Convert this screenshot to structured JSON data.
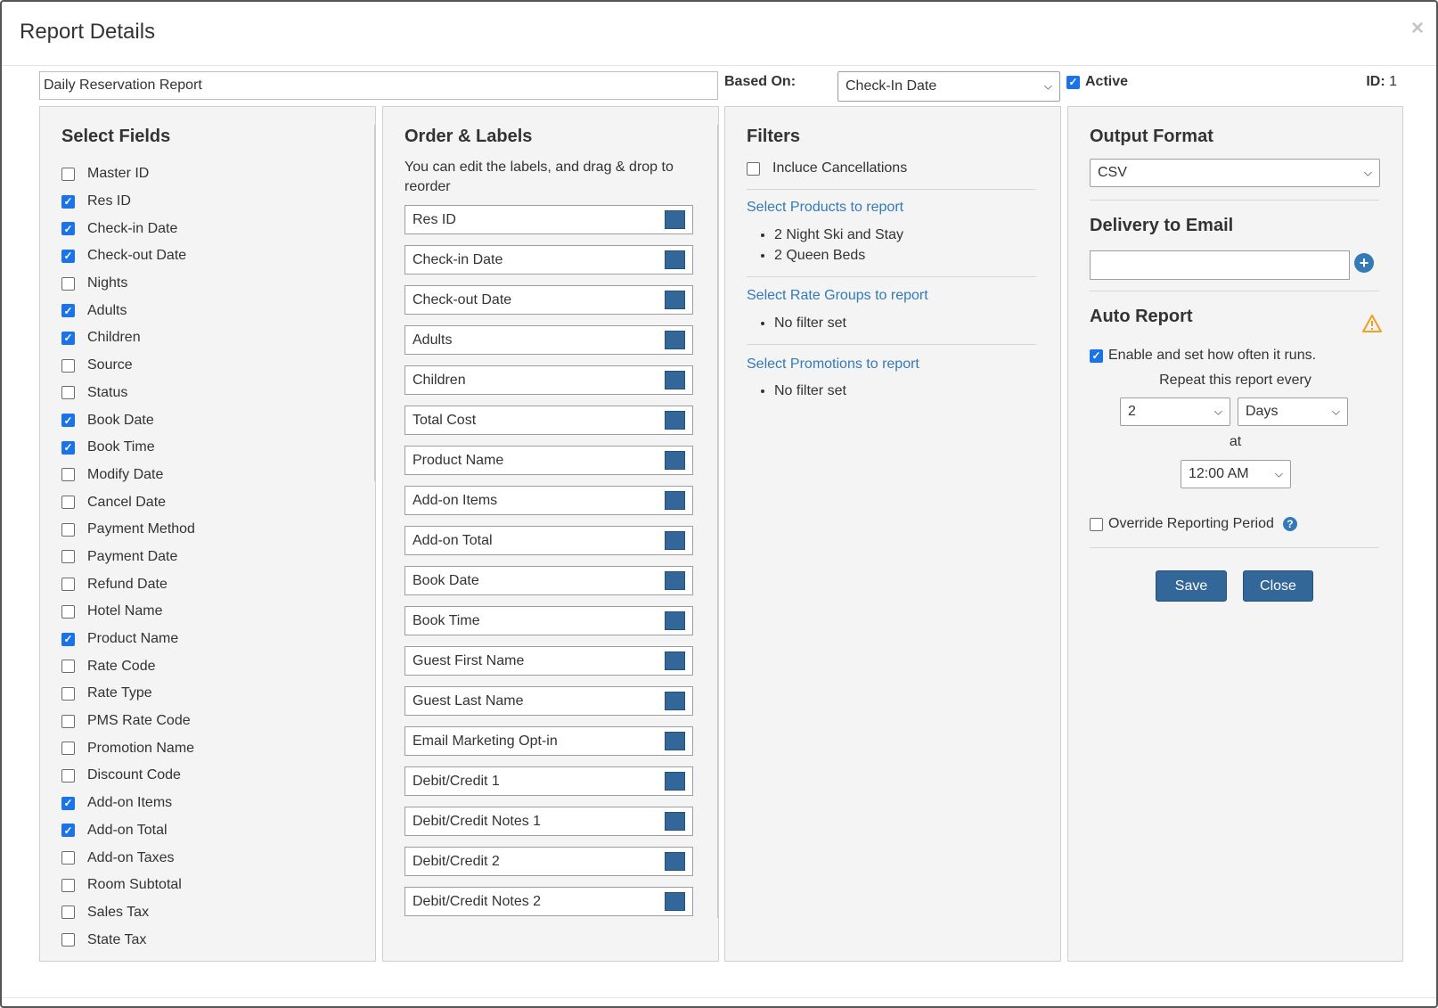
{
  "header": {
    "title": "Report Details",
    "close_symbol": "×"
  },
  "top": {
    "report_name": "Daily Reservation Report",
    "based_on_label": "Based On:",
    "based_on_value": "Check-In Date",
    "active_label": "Active",
    "active_checked": true,
    "id_label": "ID:",
    "id_value": "1"
  },
  "select_fields": {
    "title": "Select Fields",
    "items": [
      {
        "label": "Master ID",
        "checked": false
      },
      {
        "label": "Res ID",
        "checked": true
      },
      {
        "label": "Check-in Date",
        "checked": true
      },
      {
        "label": "Check-out Date",
        "checked": true
      },
      {
        "label": "Nights",
        "checked": false
      },
      {
        "label": "Adults",
        "checked": true
      },
      {
        "label": "Children",
        "checked": true
      },
      {
        "label": "Source",
        "checked": false
      },
      {
        "label": "Status",
        "checked": false
      },
      {
        "label": "Book Date",
        "checked": true
      },
      {
        "label": "Book Time",
        "checked": true
      },
      {
        "label": "Modify Date",
        "checked": false
      },
      {
        "label": "Cancel Date",
        "checked": false
      },
      {
        "label": "Payment Method",
        "checked": false
      },
      {
        "label": "Payment Date",
        "checked": false
      },
      {
        "label": "Refund Date",
        "checked": false
      },
      {
        "label": "Hotel Name",
        "checked": false
      },
      {
        "label": "Product Name",
        "checked": true
      },
      {
        "label": "Rate Code",
        "checked": false
      },
      {
        "label": "Rate Type",
        "checked": false
      },
      {
        "label": "PMS Rate Code",
        "checked": false
      },
      {
        "label": "Promotion Name",
        "checked": false
      },
      {
        "label": "Discount Code",
        "checked": false
      },
      {
        "label": "Add-on Items",
        "checked": true
      },
      {
        "label": "Add-on Total",
        "checked": true
      },
      {
        "label": "Add-on Taxes",
        "checked": false
      },
      {
        "label": "Room Subtotal",
        "checked": false
      },
      {
        "label": "Sales Tax",
        "checked": false
      },
      {
        "label": "State Tax",
        "checked": false
      }
    ]
  },
  "order_labels": {
    "title": "Order & Labels",
    "hint": "You can edit the labels, and drag & drop to reorder",
    "swatch_color": "#336699",
    "items": [
      "Res ID",
      "Check-in Date",
      "Check-out Date",
      "Adults",
      "Children",
      "Total Cost",
      "Product Name",
      "Add-on Items",
      "Add-on Total",
      "Book Date",
      "Book Time",
      "Guest First Name",
      "Guest Last Name",
      "Email Marketing Opt-in",
      "Debit/Credit 1",
      "Debit/Credit Notes 1",
      "Debit/Credit 2",
      "Debit/Credit Notes 2"
    ]
  },
  "filters": {
    "title": "Filters",
    "include_cancellations_label": "Incluce Cancellations",
    "include_cancellations_checked": false,
    "products_link": "Select Products to report",
    "products": [
      "2 Night Ski and Stay",
      "2 Queen Beds"
    ],
    "rate_groups_link": "Select Rate Groups to report",
    "rate_groups": [
      "No filter set"
    ],
    "promotions_link": "Select Promotions to report",
    "promotions": [
      "No filter set"
    ]
  },
  "output": {
    "title": "Output Format",
    "format_value": "CSV",
    "delivery_title": "Delivery to Email",
    "email_value": "",
    "auto_title": "Auto Report",
    "enable_label": "Enable and set how often it runs.",
    "enable_checked": true,
    "repeat_text": "Repeat this report every",
    "repeat_number": "2",
    "repeat_unit": "Days",
    "at_text": "at",
    "time_value": "12:00 AM",
    "override_label": "Override Reporting Period",
    "override_checked": false,
    "save_label": "Save",
    "close_label": "Close",
    "accent_color": "#337ab7",
    "button_color": "#336699",
    "warning_color": "#f0a020"
  }
}
